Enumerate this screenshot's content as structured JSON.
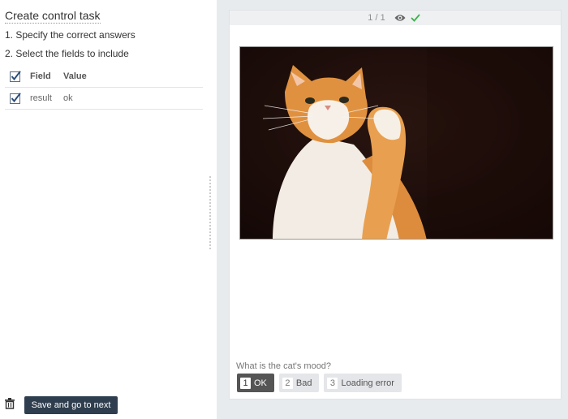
{
  "left": {
    "title": "Create control task",
    "step1": "1. Specify the correct answers",
    "step2": "2. Select the fields to include",
    "table": {
      "headers": {
        "field": "Field",
        "value": "Value"
      },
      "rows": [
        {
          "field": "result",
          "value": "ok",
          "checked": true
        }
      ]
    },
    "save_label": "Save and go to next"
  },
  "preview": {
    "counter": "1 / 1",
    "question": "What is the cat's mood?",
    "answers": [
      {
        "key": "1",
        "label": "OK",
        "selected": true
      },
      {
        "key": "2",
        "label": "Bad",
        "selected": false
      },
      {
        "key": "3",
        "label": "Loading error",
        "selected": false
      }
    ]
  },
  "colors": {
    "accent": "#2f3e4e",
    "check_green": "#3bb14a",
    "panel_bg": "#e8ebee"
  },
  "icons": {
    "visibility": "eye-icon",
    "status": "check-icon",
    "delete": "trash-icon"
  }
}
